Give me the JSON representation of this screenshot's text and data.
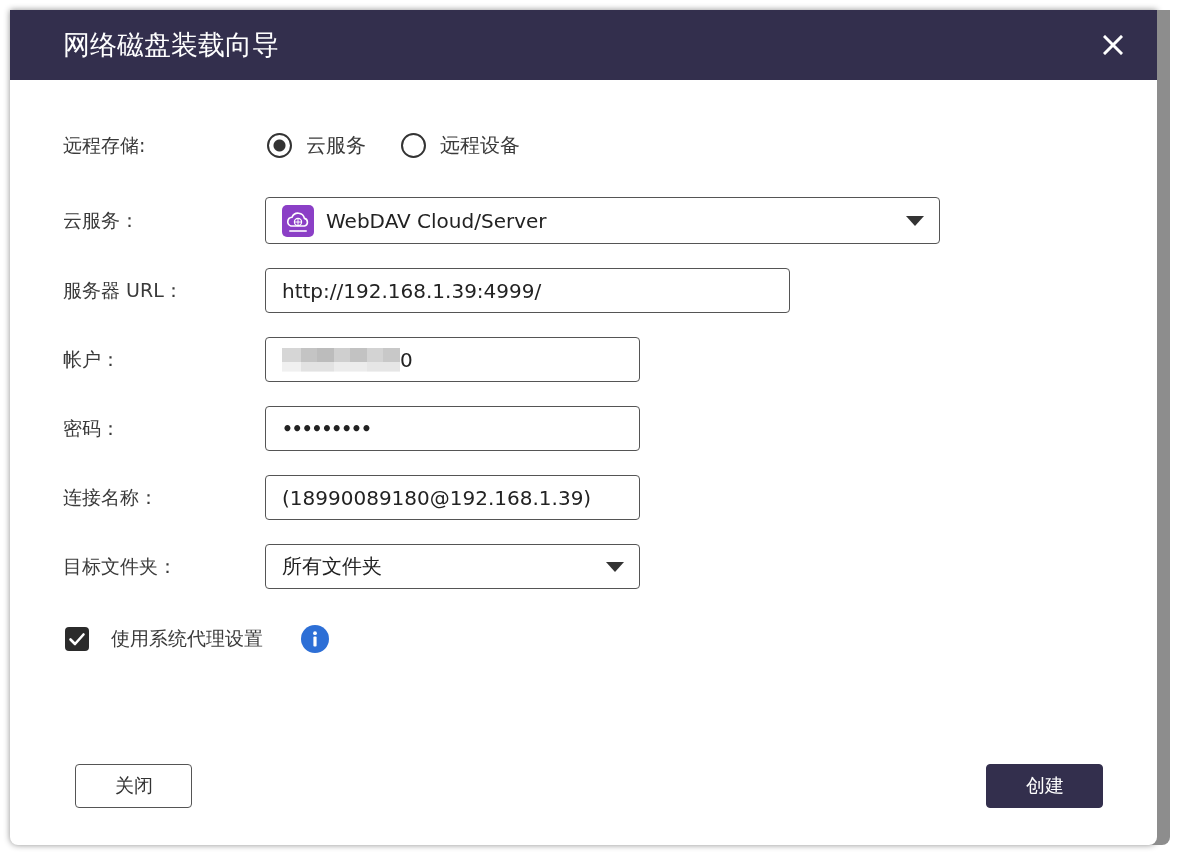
{
  "dialog": {
    "title": "网络磁盘装载向导"
  },
  "remote_storage": {
    "label": "远程存储:",
    "options": [
      {
        "label": "云服务",
        "selected": true
      },
      {
        "label": "远程设备",
        "selected": false
      }
    ]
  },
  "fields": [
    {
      "kind": "service-select",
      "label": "云服务：",
      "value": "WebDAV Cloud/Server"
    },
    {
      "kind": "text",
      "label": "服务器 URL：",
      "value": "http://192.168.1.39:4999/"
    },
    {
      "kind": "text",
      "label": "帐户：",
      "value": "0",
      "redacted": true
    },
    {
      "kind": "password",
      "label": "密码：",
      "value": "•••••••••"
    },
    {
      "kind": "text",
      "label": "连接名称：",
      "value": "(18990089180@192.168.1.39)"
    },
    {
      "kind": "select",
      "label": "目标文件夹：",
      "value": "所有文件夹"
    }
  ],
  "proxy": {
    "label": "使用系统代理设置",
    "checked": true
  },
  "buttons": [
    {
      "label": "关闭",
      "kind": "secondary"
    },
    {
      "label": "创建",
      "kind": "primary"
    }
  ]
}
